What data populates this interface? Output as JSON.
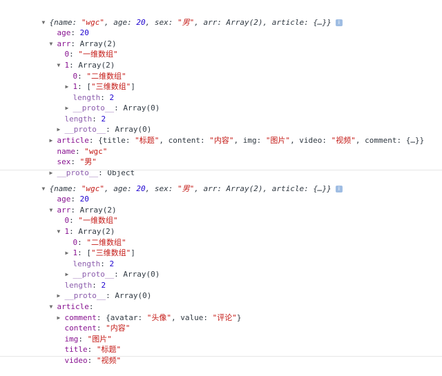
{
  "b1": {
    "summary": {
      "p1": "{name: ",
      "v1": "\"wgc\"",
      "p2": ", age: ",
      "v2": "20",
      "p3": ", sex: ",
      "v3": "\"男\"",
      "p4": ", arr: Array(2), article: {…}}"
    },
    "info": "i",
    "age": {
      "k": "age",
      "sep": ": ",
      "v": "20"
    },
    "arr": {
      "k": "arr",
      "sep": ": ",
      "v": "Array(2)"
    },
    "arr0": {
      "k": "0",
      "sep": ": ",
      "v": "\"一维数组\""
    },
    "arr1": {
      "k": "1",
      "sep": ": ",
      "v": "Array(2)"
    },
    "arr1_0": {
      "k": "0",
      "sep": ": ",
      "v": "\"二维数组\""
    },
    "arr1_1": {
      "k": "1",
      "sep": ": [",
      "v": "\"三维数组\"",
      "end": "]"
    },
    "arr1_len": {
      "k": "length",
      "sep": ": ",
      "v": "2"
    },
    "arr1_proto": {
      "k": "__proto__",
      "sep": ": ",
      "v": "Array(0)"
    },
    "arr_len": {
      "k": "length",
      "sep": ": ",
      "v": "2"
    },
    "arr_proto": {
      "k": "__proto__",
      "sep": ": ",
      "v": "Array(0)"
    },
    "article": {
      "k": "article",
      "p1": ": {title: ",
      "v1": "\"标题\"",
      "p2": ", content: ",
      "v2": "\"内容\"",
      "p3": ", img: ",
      "v3": "\"图片\"",
      "p4": ", video: ",
      "v4": "\"视频\"",
      "p5": ", comment: {…}}"
    },
    "name": {
      "k": "name",
      "sep": ": ",
      "v": "\"wgc\""
    },
    "sex": {
      "k": "sex",
      "sep": ": ",
      "v": "\"男\""
    },
    "proto": {
      "k": "__proto__",
      "sep": ": ",
      "v": "Object"
    }
  },
  "b2": {
    "summary": {
      "p1": "{name: ",
      "v1": "\"wgc\"",
      "p2": ", age: ",
      "v2": "20",
      "p3": ", sex: ",
      "v3": "\"男\"",
      "p4": ", arr: Array(2), article: {…}}"
    },
    "info": "i",
    "age": {
      "k": "age",
      "sep": ": ",
      "v": "20"
    },
    "arr": {
      "k": "arr",
      "sep": ": ",
      "v": "Array(2)"
    },
    "arr0": {
      "k": "0",
      "sep": ": ",
      "v": "\"一维数组\""
    },
    "arr1": {
      "k": "1",
      "sep": ": ",
      "v": "Array(2)"
    },
    "arr1_0": {
      "k": "0",
      "sep": ": ",
      "v": "\"二维数组\""
    },
    "arr1_1": {
      "k": "1",
      "sep": ": [",
      "v": "\"三维数组\"",
      "end": "]"
    },
    "arr1_len": {
      "k": "length",
      "sep": ": ",
      "v": "2"
    },
    "arr1_proto": {
      "k": "__proto__",
      "sep": ": ",
      "v": "Array(0)"
    },
    "arr_len": {
      "k": "length",
      "sep": ": ",
      "v": "2"
    },
    "arr_proto": {
      "k": "__proto__",
      "sep": ": ",
      "v": "Array(0)"
    },
    "article": {
      "k": "article",
      "sep": ":"
    },
    "comment": {
      "k": "comment",
      "p1": ": {avatar: ",
      "v1": "\"头像\"",
      "p2": ", value: ",
      "v2": "\"评论\"",
      "p3": "}"
    },
    "content": {
      "k": "content",
      "sep": ": ",
      "v": "\"内容\""
    },
    "img": {
      "k": "img",
      "sep": ": ",
      "v": "\"图片\""
    },
    "title": {
      "k": "title",
      "sep": ": ",
      "v": "\"标题\""
    },
    "video": {
      "k": "video",
      "sep": ": ",
      "v": "\"视频\""
    }
  },
  "icons": {
    "expanded": "▼",
    "collapsed": "▶"
  }
}
